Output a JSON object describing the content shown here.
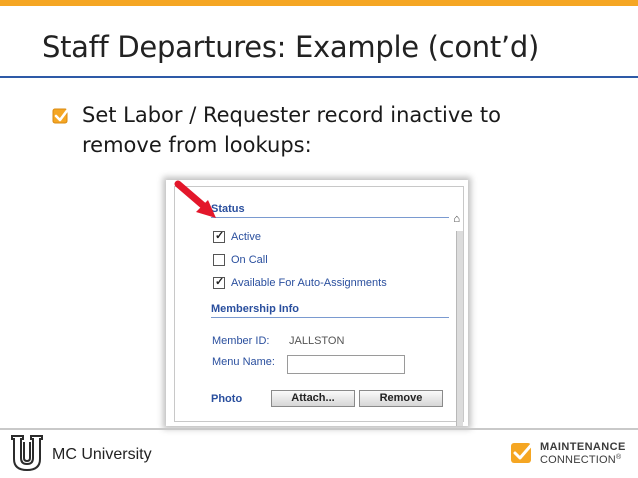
{
  "slide": {
    "title": "Staff Departures: Example (cont’d)",
    "bullet": "Set Labor / Requester record inactive to remove from lookups:",
    "bullet_icon": "checkbox-checked-icon"
  },
  "screenshot": {
    "status_header": "Status",
    "checkboxes": [
      {
        "label": "Active",
        "checked": true
      },
      {
        "label": "On Call",
        "checked": false
      },
      {
        "label": "Available For Auto-Assignments",
        "checked": true
      }
    ],
    "membership_header": "Membership Info",
    "member_id_label": "Member ID:",
    "member_id_value": "JALLSTON",
    "menu_name_label": "Menu Name:",
    "menu_name_value": "",
    "photo_label": "Photo",
    "attach_button": "Attach...",
    "remove_button": "Remove"
  },
  "footer": {
    "left_text": "MC University",
    "brand_line1": "MAINTENANCE",
    "brand_line2": "CONNECTION",
    "brand_mark": "®"
  },
  "colors": {
    "accent": "#f5a623",
    "title_rule": "#2e5aa7",
    "link_blue": "#2a4f9e",
    "arrow_red": "#e3172b"
  }
}
